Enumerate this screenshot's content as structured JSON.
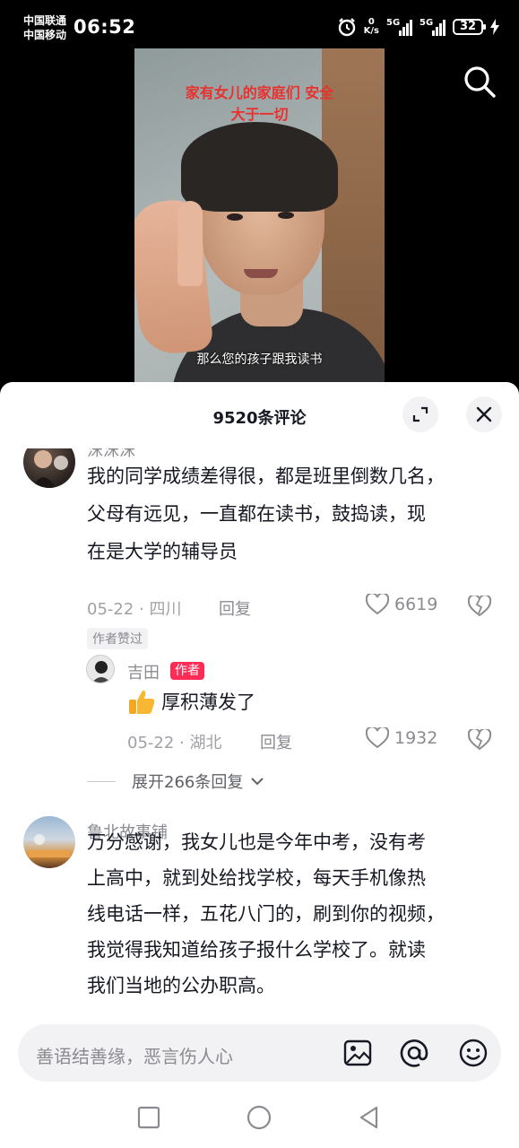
{
  "status_bar": {
    "carrier_1": "中国联通",
    "carrier_2": "中国移动",
    "time": "06:52",
    "net_speed_value": "0",
    "net_speed_unit": "K/s",
    "network_1": "5G",
    "network_2": "5G",
    "battery": "32"
  },
  "video": {
    "overlay_line_1": "家有女儿的家庭们 安全",
    "overlay_line_2": "大于一切",
    "subtitle": "那么您的孩子跟我读书"
  },
  "comments_panel": {
    "title": "9520条评论"
  },
  "comments": [
    {
      "username": "沫沫沫",
      "text_lines": [
        "我的同学成绩差得很，都是班里倒数几名，",
        "父母有远见，一直都在读书，鼓捣读，现",
        "在是大学的辅导员"
      ],
      "date": "05-22",
      "location": "四川",
      "date_location": "05-22 · 四川",
      "reply_label": "回复",
      "likes": "6619",
      "author_liked_label": "作者赞过",
      "reply": {
        "username": "吉田",
        "badge": "作者",
        "text": "厚积薄发了",
        "date_location": "05-22 · 湖北",
        "reply_label": "回复",
        "likes": "1932"
      },
      "expand_replies_label": "展开266条回复"
    },
    {
      "username": "鲁北故事铺",
      "text_lines": [
        "万分感谢，我女儿也是今年中考，没有考",
        "上高中，就到处给找学校，每天手机像热",
        "线电话一样，五花八门的，刷到你的视频，",
        "我觉得我知道给孩子报什么学校了。就读",
        "我们当地的公办职高。"
      ]
    }
  ],
  "input_bar": {
    "placeholder": "善语结善缘，恶言伤人心"
  },
  "colors": {
    "accent": "#fe2c55",
    "overlay_text": "#e8302d",
    "secondary_text": "#8a8b91"
  },
  "icons": [
    "search-icon",
    "expand-icon",
    "close-icon",
    "heart-icon",
    "broken-heart-icon",
    "chevron-down-icon",
    "image-icon",
    "at-icon",
    "emoji-icon",
    "thumbs-up-emoji",
    "recent-apps-icon",
    "home-icon",
    "back-icon"
  ]
}
